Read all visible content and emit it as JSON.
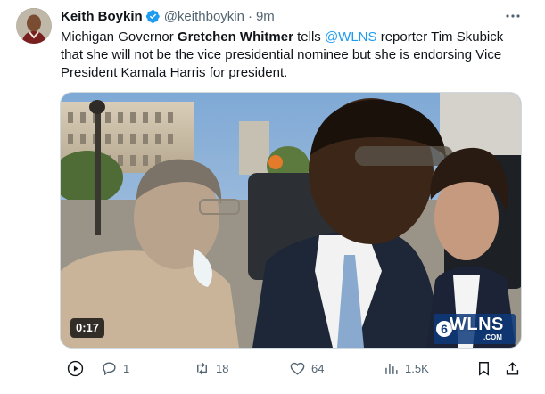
{
  "author": {
    "name": "Keith Boykin",
    "handle": "@keithboykin",
    "separator": "·",
    "time": "9m"
  },
  "tweet": {
    "part1": "Michigan Governor ",
    "bold_name": "Gretchen Whitmer",
    "part2": " tells ",
    "mention": "@WLNS",
    "part3": " reporter Tim Skubick that she will not be the vice presidential nominee but she is endorsing Vice President Kamala Harris for president."
  },
  "video": {
    "duration": "0:17",
    "logo_text": "WLNS",
    "logo_sub": ".COM"
  },
  "actions": {
    "replies": "1",
    "reposts": "18",
    "likes": "64",
    "views": "1.5K"
  },
  "icons": [
    "verified-badge-icon",
    "more-icon",
    "play-icon",
    "reply-icon",
    "repost-icon",
    "like-icon",
    "views-icon",
    "bookmark-icon",
    "share-icon"
  ],
  "colors": {
    "accent": "#1d9bf0",
    "secondary_text": "#536471",
    "primary_text": "#0f1419"
  }
}
